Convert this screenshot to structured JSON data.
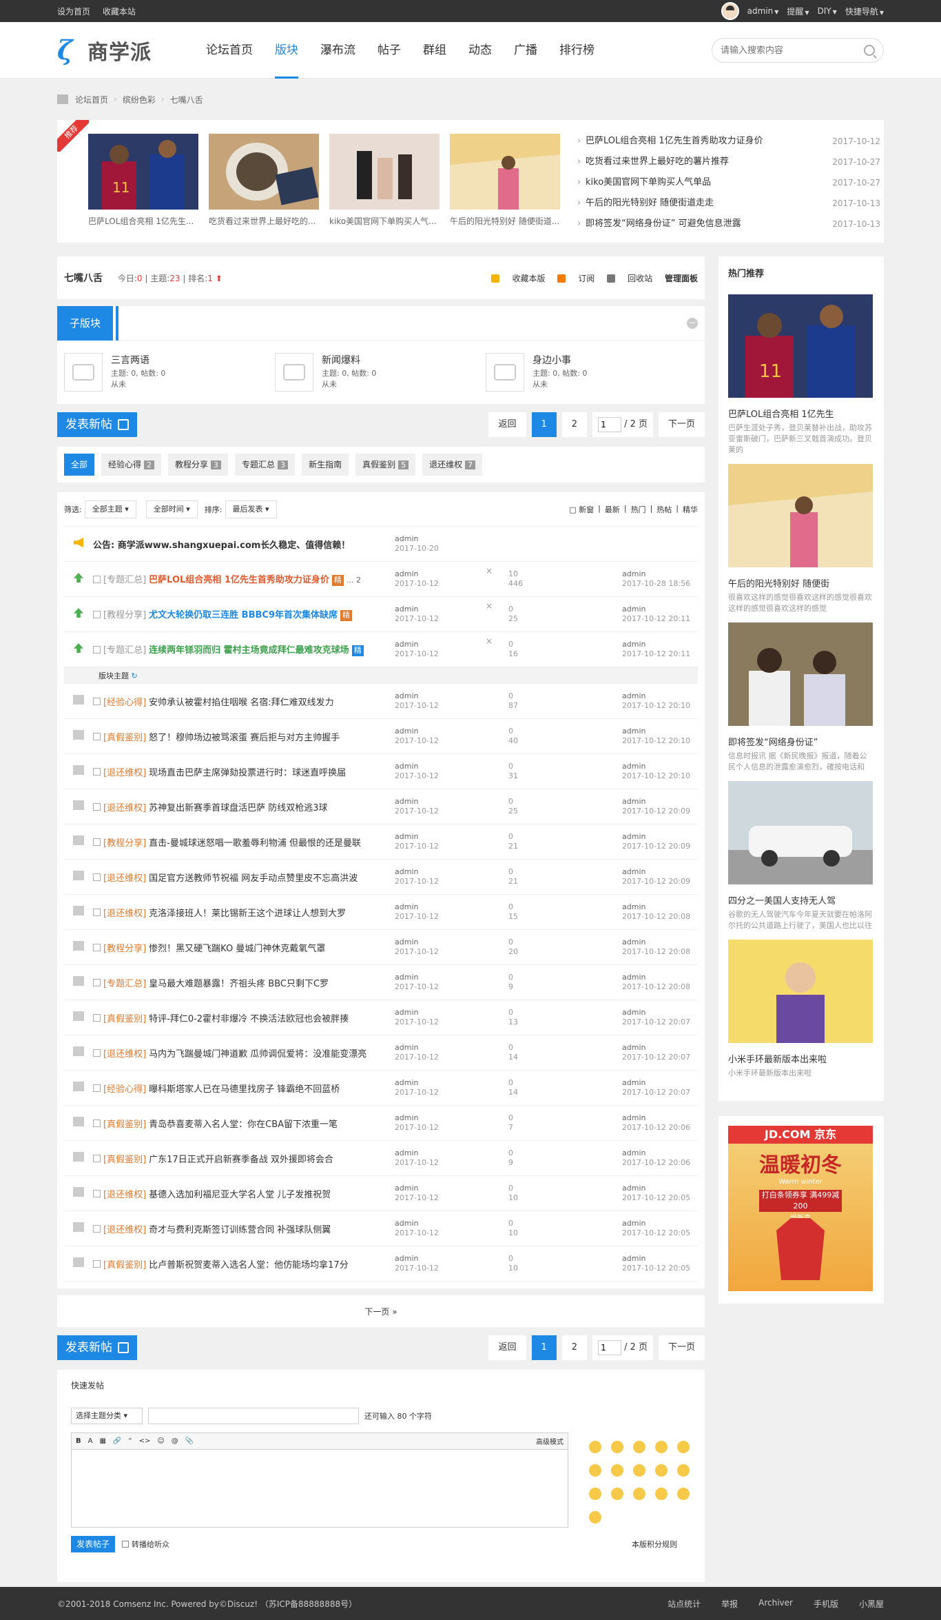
{
  "topbar": {
    "set_home": "设为首页",
    "bookmark": "收藏本站",
    "user": "admin",
    "remind": "提醒",
    "diy": "DIY",
    "quicknav": "快捷导航"
  },
  "header": {
    "logo_text": "商学派",
    "nav": [
      "论坛首页",
      "版块",
      "瀑布流",
      "帖子",
      "群组",
      "动态",
      "广播",
      "排行榜"
    ],
    "search_placeholder": "请输入搜索内容"
  },
  "breadcrumb": [
    "论坛首页",
    "缤纷色彩",
    "七嘴八舌"
  ],
  "recommend": {
    "tag": "推荐",
    "items": [
      {
        "caption": "巴萨LOL组合亮相 1亿先生..."
      },
      {
        "caption": "吃货看过来世界上最好吃的..."
      },
      {
        "caption": "kiko美国官网下单购买人气..."
      },
      {
        "caption": "午后的阳光特别好 随便街道..."
      }
    ],
    "list": [
      {
        "title": "巴萨LOL组合亮相 1亿先生首秀助攻力证身价",
        "date": "2017-10-12"
      },
      {
        "title": "吃货看过来世界上最好吃的薯片推荐",
        "date": "2017-10-27"
      },
      {
        "title": "kiko美国官网下单购买人气单品",
        "date": "2017-10-27"
      },
      {
        "title": "午后的阳光特别好 随便街道走走",
        "date": "2017-10-13"
      },
      {
        "title": "即将签发“网络身份证” 可避免信息泄露",
        "date": "2017-10-13"
      }
    ]
  },
  "forum": {
    "name": "七嘴八舌",
    "today_label": "今日:",
    "today": "0",
    "topics_label": "主题:",
    "topics": "23",
    "rank_label": "排名:",
    "rank": "1",
    "actions": [
      "收藏本版",
      "订阅",
      "回收站",
      "管理面板"
    ]
  },
  "subforums": {
    "title": "子版块",
    "items": [
      {
        "name": "三言两语",
        "stats": "主题: 0, 帖数: 0",
        "last": "从未"
      },
      {
        "name": "新闻爆料",
        "stats": "主题: 0, 帖数: 0",
        "last": "从未"
      },
      {
        "name": "身边小事",
        "stats": "主题: 0, 帖数: 0",
        "last": "从未"
      }
    ]
  },
  "pager": {
    "post_label": "发表新帖",
    "back": "返回",
    "p1": "1",
    "p2": "2",
    "page_input": "1",
    "total": "/ 2 页",
    "next": "下一页"
  },
  "types": [
    {
      "name": "全部"
    },
    {
      "name": "经验心得",
      "n": "2"
    },
    {
      "name": "教程分享",
      "n": "3"
    },
    {
      "name": "专题汇总",
      "n": "3"
    },
    {
      "name": "新生指南"
    },
    {
      "name": "真假鉴别",
      "n": "5"
    },
    {
      "name": "退还维权",
      "n": "7"
    }
  ],
  "filter": {
    "label": "筛选:",
    "sel1": "全部主题",
    "sel2": "全部时间",
    "sort_label": "排序:",
    "sel3": "最后发表",
    "opts": [
      "新窗",
      "最新",
      "热门",
      "热帖",
      "精华"
    ]
  },
  "announce": {
    "title": "公告: 商学派www.shangxuepai.com长久稳定、值得信赖！",
    "author": "admin",
    "date": "2017-10-20"
  },
  "sticky": [
    {
      "type": "[专题汇总]",
      "title": "巴萨LOL组合亮相 1亿先生首秀助攻力证身价",
      "color": "#e05a2b",
      "badge": "精",
      "badge_blue": false,
      "pages": "... 2",
      "author": "admin",
      "date": "2017-10-12",
      "replies": "10",
      "views": "446",
      "last_user": "admin",
      "last_date": "2017-10-28 18:56"
    },
    {
      "type": "[教程分享]",
      "title": "尤文大轮换仍取三连胜 BBBC9年首次集体缺席",
      "color": "#1e88e5",
      "badge": "精",
      "badge_blue": false,
      "pages": "",
      "author": "admin",
      "date": "2017-10-12",
      "replies": "0",
      "views": "25",
      "last_user": "admin",
      "last_date": "2017-10-12 20:11"
    },
    {
      "type": "[专题汇总]",
      "title": "连续两年铩羽而归 霍村主场竟成拜仁最难攻克球场",
      "color": "#3aa04a",
      "badge": "精",
      "badge_blue": true,
      "pages": "",
      "author": "admin",
      "date": "2017-10-12",
      "replies": "0",
      "views": "16",
      "last_user": "admin",
      "last_date": "2017-10-12 20:11"
    }
  ],
  "section_label": "版块主题",
  "threads": [
    {
      "type": "[经验心得]",
      "title": "安帅承认被霍村掐住咽喉 名宿:拜仁难双线发力",
      "date": "2017-10-12",
      "replies": "0",
      "views": "87",
      "last": "2017-10-12 20:10"
    },
    {
      "type": "[真假鉴别]",
      "title": "怒了！穆帅场边被骂滚蛋 赛后拒与对方主帅握手",
      "date": "2017-10-12",
      "replies": "0",
      "views": "40",
      "last": "2017-10-12 20:10"
    },
    {
      "type": "[退还维权]",
      "title": "现场直击巴萨主席弹劾投票进行时：球迷直呼换届",
      "date": "2017-10-12",
      "replies": "0",
      "views": "31",
      "last": "2017-10-12 20:10"
    },
    {
      "type": "[退还维权]",
      "title": "苏神复出新赛季首球盘活巴萨 防线双枪逃3球",
      "date": "2017-10-12",
      "replies": "0",
      "views": "25",
      "last": "2017-10-12 20:09"
    },
    {
      "type": "[教程分享]",
      "title": "直击-曼城球迷怒唱一歌羞辱利物浦 但最恨的还是曼联",
      "date": "2017-10-12",
      "replies": "0",
      "views": "21",
      "last": "2017-10-12 20:09"
    },
    {
      "type": "[退还维权]",
      "title": "国足官方送教师节祝福 网友手动点赞里皮不忘高洪波",
      "date": "2017-10-12",
      "replies": "0",
      "views": "21",
      "last": "2017-10-12 20:09"
    },
    {
      "type": "[退还维权]",
      "title": "克洛泽接班人！莱比锡新王这个进球让人想到大罗",
      "date": "2017-10-12",
      "replies": "0",
      "views": "15",
      "last": "2017-10-12 20:08"
    },
    {
      "type": "[教程分享]",
      "title": "惨烈！黑又硬飞踹KO 曼城门神休克戴氧气罩",
      "date": "2017-10-12",
      "replies": "0",
      "views": "20",
      "last": "2017-10-12 20:08"
    },
    {
      "type": "[专题汇总]",
      "title": "皇马最大难题暴露！齐祖头疼 BBC只剩下C罗",
      "date": "2017-10-12",
      "replies": "0",
      "views": "9",
      "last": "2017-10-12 20:08"
    },
    {
      "type": "[真假鉴别]",
      "title": "特评-拜仁0-2霍村非爆冷 不换活法欧冠也会被胖揍",
      "date": "2017-10-12",
      "replies": "0",
      "views": "13",
      "last": "2017-10-12 20:07"
    },
    {
      "type": "[退还维权]",
      "title": "马内为飞踹曼城门神道歉 瓜帅调侃爱将：没准能变漂亮",
      "date": "2017-10-12",
      "replies": "0",
      "views": "14",
      "last": "2017-10-12 20:07"
    },
    {
      "type": "[经验心得]",
      "title": "曝科斯塔家人已在马德里找房子 锋霸绝不回蓝桥",
      "date": "2017-10-12",
      "replies": "0",
      "views": "14",
      "last": "2017-10-12 20:07"
    },
    {
      "type": "[真假鉴别]",
      "title": "青岛恭喜麦蒂入名人堂：你在CBA留下浓重一笔",
      "date": "2017-10-12",
      "replies": "0",
      "views": "7",
      "last": "2017-10-12 20:06"
    },
    {
      "type": "[真假鉴别]",
      "title": "广东17日正式开启新赛季备战 双外援即将会合",
      "date": "2017-10-12",
      "replies": "0",
      "views": "9",
      "last": "2017-10-12 20:06"
    },
    {
      "type": "[退还维权]",
      "title": "基德入选加利福尼亚大学名人堂 儿子发推祝贺",
      "date": "2017-10-12",
      "replies": "0",
      "views": "10",
      "last": "2017-10-12 20:05"
    },
    {
      "type": "[退还维权]",
      "title": "奇才与费利克斯签订训练营合同 补强球队侧翼",
      "date": "2017-10-12",
      "replies": "0",
      "views": "10",
      "last": "2017-10-12 20:05"
    },
    {
      "type": "[真假鉴别]",
      "title": "比卢普斯祝贺麦蒂入选名人堂：他仿能场均拿17分",
      "date": "2017-10-12",
      "replies": "0",
      "views": "10",
      "last": "2017-10-12 20:05"
    }
  ],
  "thread_author": "admin",
  "next_page": "下一页 »",
  "quickpost": {
    "title": "快速发帖",
    "type_select": "选择主题分类",
    "remain": "还可输入 80 个字符",
    "advanced": "高级模式",
    "submit": "发表帖子",
    "sync": "转播给听众",
    "rules": "本版积分规则",
    "tb": [
      "B",
      "A",
      "▦",
      "🔗",
      "“",
      "<>",
      "☺",
      "@",
      "📎"
    ]
  },
  "side": {
    "title": "热门推荐",
    "items": [
      {
        "title": "巴萨LOL组合亮相 1亿先生",
        "desc": "巴萨生涯处子秀，登贝莱替补出战，助攻苏亚雷斯破门，巴萨新三叉戟首演成功。登贝莱的"
      },
      {
        "title": "午后的阳光特别好 随便街",
        "desc": "很喜欢这样的感觉很喜欢这样的感觉很喜欢这样的感觉很喜欢这样的感觉"
      },
      {
        "title": "即将签发“网络身份证”",
        "desc": "信息时报讯 据《新民晚报》报道，随着公民个人信息的泄露愈演愈烈，確按电话和"
      },
      {
        "title": "四分之一美国人支持无人驾",
        "desc": "谷歌的无人驾驶汽车今年夏天就要在帕洛阿尔托的公共道路上行驶了，美国人也比以往"
      },
      {
        "title": "小米手环最新版本出来啦",
        "desc": "小米手环最新版本出来啦"
      }
    ]
  },
  "ad": {
    "brand": "JD.COM 京东",
    "title": "温暖初冬",
    "sub": "Warm winter",
    "coupon": "打白条领券享 满499减200",
    "tag": "尚新喜"
  },
  "footer": {
    "copy": "©2001-2018  Comsenz Inc.  Powered by©Discuz!  （苏ICP备88888888号）",
    "links": [
      "站点统计",
      "举报",
      "Archiver",
      "手机版",
      "小黑屋"
    ]
  }
}
